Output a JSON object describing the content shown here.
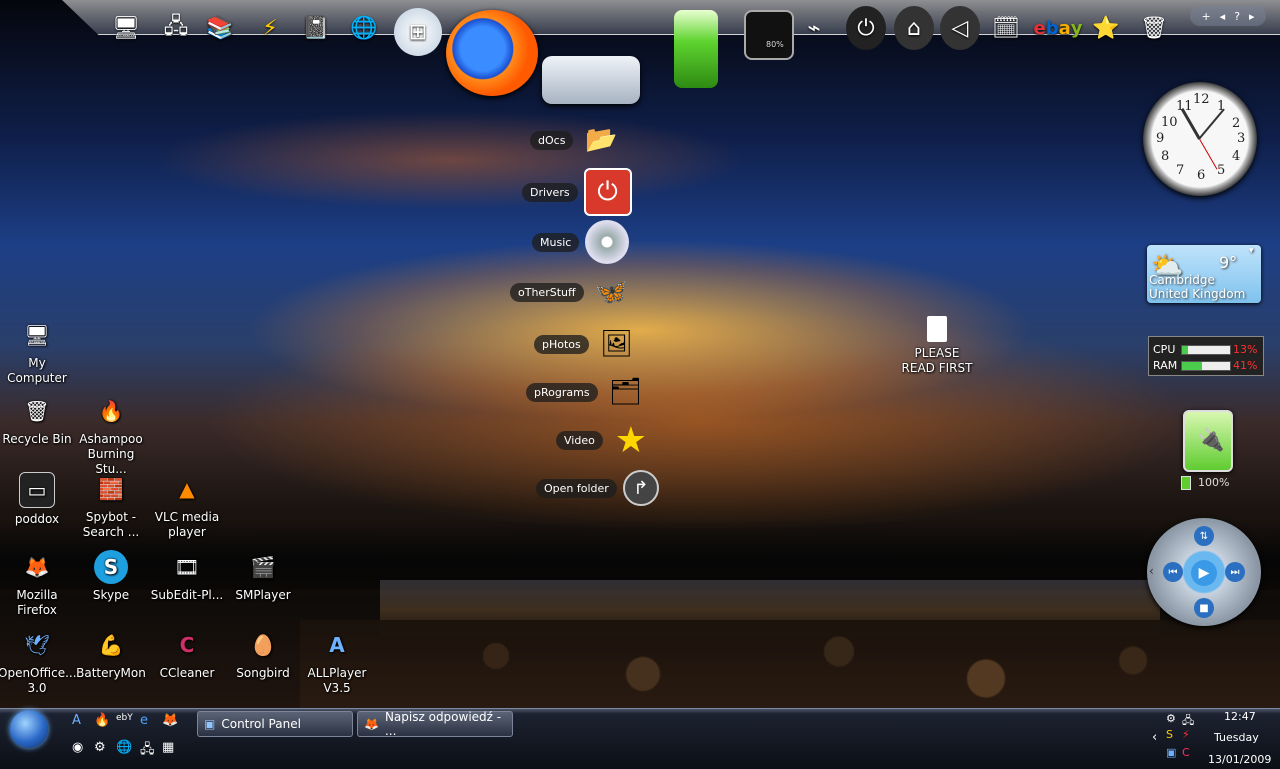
{
  "dock": {
    "nav": [
      "+",
      "◂",
      "?",
      "▸"
    ],
    "battery_percent": "80%"
  },
  "stack": [
    {
      "label": "dOcs",
      "icon": "folder-icon"
    },
    {
      "label": "Drivers",
      "icon": "power-icon"
    },
    {
      "label": "Music",
      "icon": "cd-icon"
    },
    {
      "label": "oTherStuff",
      "icon": "msn-icon"
    },
    {
      "label": "pHotos",
      "icon": "photos-icon"
    },
    {
      "label": "pRograms",
      "icon": "programs-icon"
    },
    {
      "label": "Video",
      "icon": "star-icon"
    },
    {
      "label": "Open folder",
      "icon": "open-folder-icon"
    }
  ],
  "desktop": {
    "my_computer": "My Computer",
    "recycle_bin": "Recycle Bin",
    "ashampoo": "Ashampoo Burning Stu...",
    "poddox": "poddox",
    "spybot": "Spybot - Search ...",
    "vlc": "VLC media player",
    "firefox": "Mozilla Firefox",
    "skype": "Skype",
    "subedit": "SubEdit-Pl...",
    "smplayer": "SMPlayer",
    "openoffice": "OpenOffice... 3.0",
    "batterymon": "BatteryMon",
    "ccleaner": "CCleaner",
    "songbird": "Songbird",
    "allplayer": "ALLPlayer V3.5",
    "readme": "PLEASE READ FIRST"
  },
  "weather": {
    "temp": "9°",
    "city": "Cambridge",
    "country": "United Kingdom"
  },
  "meter": {
    "cpu_label": "CPU",
    "cpu_value": "13%",
    "cpu_fraction": 0.13,
    "ram_label": "RAM",
    "ram_value": "41%",
    "ram_fraction": 0.41
  },
  "battery": {
    "percent": "100%"
  },
  "clock_numbers": [
    "12",
    "1",
    "2",
    "3",
    "4",
    "5",
    "6",
    "7",
    "8",
    "9",
    "10",
    "11"
  ],
  "taskbar": {
    "buttons": [
      "Control Panel",
      "Napisz odpowiedź - ..."
    ]
  },
  "tray": {
    "time": "12:47",
    "day": "Tuesday",
    "date": "13/01/2009"
  },
  "colors": {
    "accent": "#2a68c7",
    "meter_alert": "#ff3030"
  }
}
